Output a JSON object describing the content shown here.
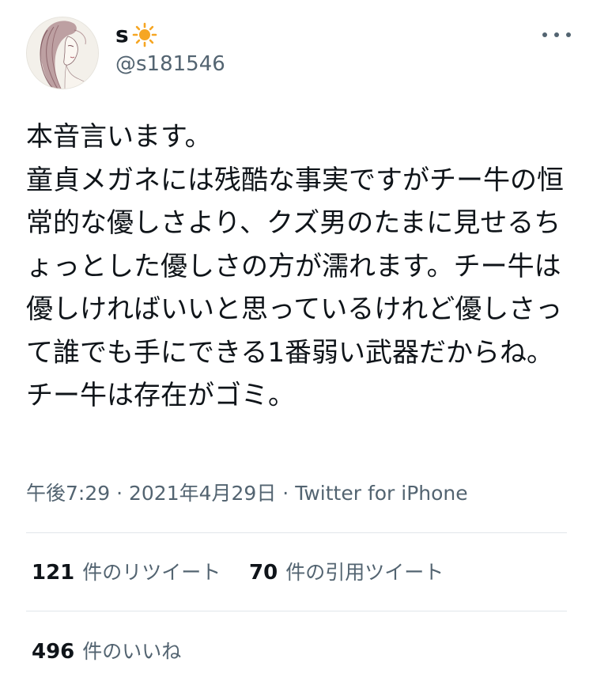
{
  "user": {
    "name": "s",
    "name_emoji": "sun-icon",
    "handle": "@s181546"
  },
  "tweet": {
    "text": "本音言います。\n童貞メガネには残酷な事実ですがチー牛の恒常的な優しさより、クズ男のたまに見せるちょっとした優しさの方が濡れます。チー牛は優しければいいと思っているけれど優しさって誰でも手にできる1番弱い武器だからね。チー牛は存在がゴミ。",
    "time": "午後7:29",
    "separator": "·",
    "date": "2021年4月29日",
    "source": "Twitter for iPhone"
  },
  "stats": {
    "retweets": {
      "count": "121",
      "label": "件のリツイート"
    },
    "quotes": {
      "count": "70",
      "label": "件の引用ツイート"
    },
    "likes": {
      "count": "496",
      "label": "件のいいね"
    }
  },
  "colors": {
    "text": "#0f1419",
    "secondary": "#536471",
    "divider": "#e1e6ea",
    "sun": "#f6a623"
  },
  "icons": {
    "more": "more-horizontal-icon",
    "avatar": "avatar-illustration"
  }
}
